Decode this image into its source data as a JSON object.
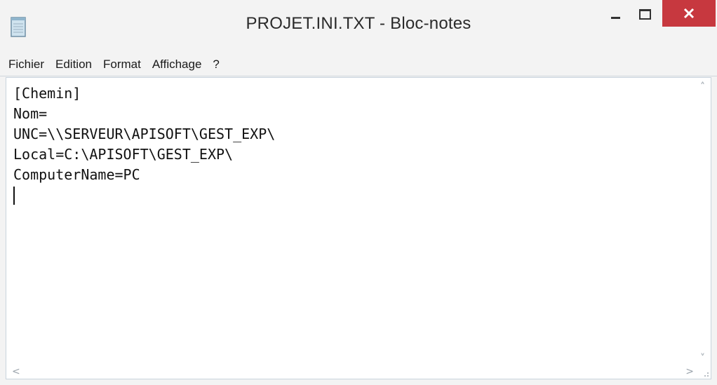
{
  "window": {
    "title": "PROJET.INI.TXT - Bloc-notes",
    "app_icon": "notepad-icon",
    "controls": {
      "minimize_icon": "minimize-icon",
      "maximize_icon": "maximize-icon",
      "close_icon": "close-icon"
    },
    "close_color": "#c7383f"
  },
  "menu": {
    "items": [
      "Fichier",
      "Edition",
      "Format",
      "Affichage",
      "?"
    ]
  },
  "editor": {
    "lines": [
      "[Chemin]",
      "Nom=",
      "UNC=\\\\SERVEUR\\APISOFT\\GEST_EXP\\",
      "Local=C:\\APISOFT\\GEST_EXP\\",
      "ComputerName=PC"
    ]
  },
  "scrollbars": {
    "up_icon": "chevron-up-icon",
    "down_icon": "chevron-down-icon",
    "left_icon": "chevron-left-icon",
    "right_icon": "chevron-right-icon"
  }
}
